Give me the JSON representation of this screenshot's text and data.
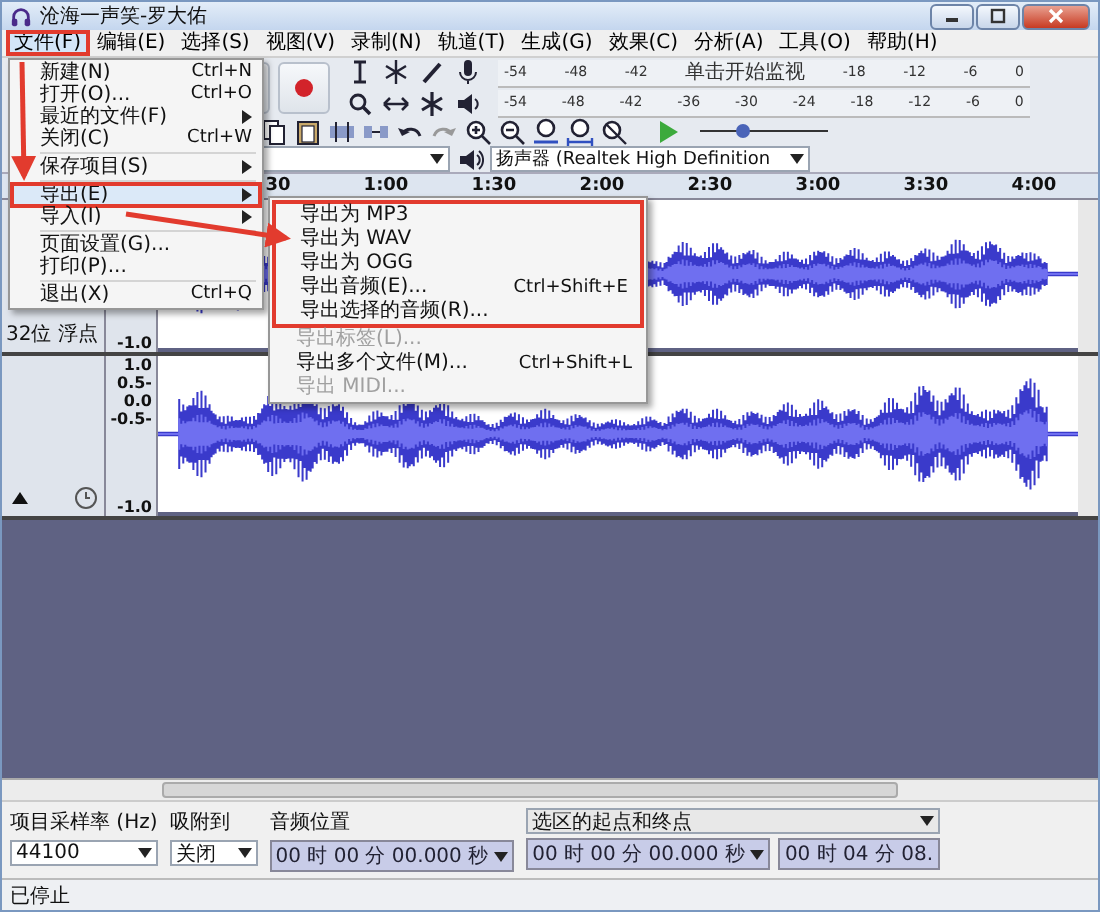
{
  "window": {
    "title": "沧海一声笑-罗大佑"
  },
  "menu_bar": [
    {
      "label": "文件(F)",
      "selected": true,
      "highlighted": true
    },
    {
      "label": "编辑(E)",
      "selected": false,
      "highlighted": false
    },
    {
      "label": "选择(S)",
      "selected": false,
      "highlighted": false
    },
    {
      "label": "视图(V)",
      "selected": false,
      "highlighted": false
    },
    {
      "label": "录制(N)",
      "selected": false,
      "highlighted": false
    },
    {
      "label": "轨道(T)",
      "selected": false,
      "highlighted": false
    },
    {
      "label": "生成(G)",
      "selected": false,
      "highlighted": false
    },
    {
      "label": "效果(C)",
      "selected": false,
      "highlighted": false
    },
    {
      "label": "分析(A)",
      "selected": false,
      "highlighted": false
    },
    {
      "label": "工具(O)",
      "selected": false,
      "highlighted": false
    },
    {
      "label": "帮助(H)",
      "selected": false,
      "highlighted": false
    }
  ],
  "file_menu": [
    {
      "kind": "item",
      "label": "新建(N)",
      "shortcut": "Ctrl+N",
      "submenu": false,
      "selected": false,
      "highlighted": false
    },
    {
      "kind": "item",
      "label": "打开(O)...",
      "shortcut": "Ctrl+O",
      "submenu": false,
      "selected": false,
      "highlighted": false
    },
    {
      "kind": "item",
      "label": "最近的文件(F)",
      "submenu": true,
      "selected": false,
      "highlighted": false
    },
    {
      "kind": "item",
      "label": "关闭(C)",
      "shortcut": "Ctrl+W",
      "submenu": false,
      "selected": false,
      "highlighted": false
    },
    {
      "kind": "separator"
    },
    {
      "kind": "item",
      "label": "保存项目(S)",
      "submenu": true,
      "selected": false,
      "highlighted": false
    },
    {
      "kind": "separator"
    },
    {
      "kind": "item",
      "label": "导出(E)",
      "submenu": true,
      "selected": true,
      "highlighted": true
    },
    {
      "kind": "item",
      "label": "导入(I)",
      "submenu": true,
      "selected": false,
      "highlighted": false
    },
    {
      "kind": "separator"
    },
    {
      "kind": "item",
      "label": "页面设置(G)...",
      "submenu": false,
      "selected": false,
      "highlighted": false
    },
    {
      "kind": "item",
      "label": "打印(P)...",
      "submenu": false,
      "selected": false,
      "highlighted": false
    },
    {
      "kind": "separator"
    },
    {
      "kind": "item",
      "label": "退出(X)",
      "shortcut": "Ctrl+Q",
      "submenu": false,
      "selected": false,
      "highlighted": false
    }
  ],
  "export_submenu": [
    {
      "label": "导出为 MP3",
      "disabled": false,
      "highlighted": true
    },
    {
      "label": "导出为 WAV",
      "disabled": false,
      "highlighted": true
    },
    {
      "label": "导出为 OGG",
      "disabled": false,
      "highlighted": true
    },
    {
      "label": "导出音频(E)...",
      "shortcut": "Ctrl+Shift+E",
      "disabled": false,
      "highlighted": true
    },
    {
      "label": "导出选择的音频(R)...",
      "disabled": false,
      "highlighted": true
    },
    {
      "label": "导出标签(L)...",
      "disabled": true,
      "highlighted": false
    },
    {
      "label": "导出多个文件(M)...",
      "shortcut": "Ctrl+Shift+L",
      "disabled": false,
      "highlighted": false
    },
    {
      "label": "导出 MIDI...",
      "disabled": true,
      "highlighted": false
    }
  ],
  "record_meter": {
    "scale": [
      "-54",
      "-48",
      "-42"
    ],
    "prompt": "单击开始监视",
    "scale_end": [
      "-18",
      "-12",
      "-6",
      "0"
    ]
  },
  "playback_meter": {
    "scale": [
      "-54",
      "-48",
      "-42",
      "-36",
      "-30",
      "-24",
      "-18",
      "-12",
      "-6",
      "0"
    ]
  },
  "play_speed": {
    "level": 0.33
  },
  "device": {
    "value": "扬声器 (Realtek High Definition"
  },
  "timeline": {
    "ticks": [
      "30",
      "1:00",
      "1:30",
      "2:00",
      "2:30",
      "3:00",
      "3:30",
      "4:00"
    ]
  },
  "tracks": [
    {
      "info": "32位 浮点",
      "scale": [
        "-1.0"
      ]
    },
    {
      "scale": [
        "1.0",
        "0.5-",
        "0.0",
        "-0.5-",
        "-1.0"
      ]
    }
  ],
  "selection_toolbar": {
    "rate_label": "项目采样率 (Hz)",
    "rate": "44100",
    "snap_label": "吸附到",
    "snap": "关闭",
    "position_label": "音频位置",
    "position": "00 时 00 分 00.000 秒",
    "selection_mode": "选区的起点和终点",
    "selection_start": "00 时 00 分 00.000 秒",
    "selection_end": "00 时 04 分 08."
  },
  "status_bar": {
    "text": "已停止"
  }
}
